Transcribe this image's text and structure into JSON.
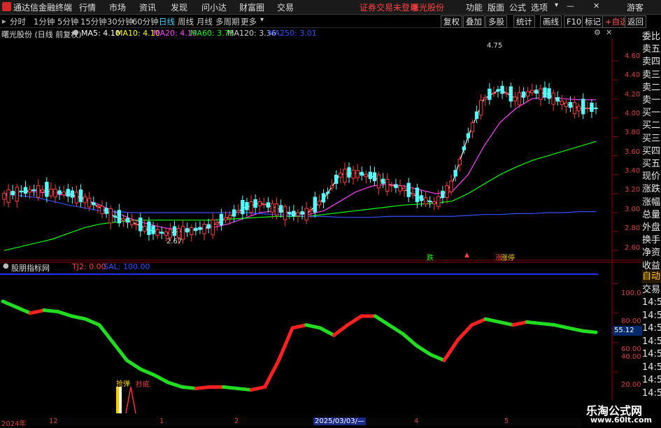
{
  "titlebar": {
    "app_title": "通达信金融终端",
    "menus": [
      "行情",
      "市场",
      "资讯",
      "发现",
      "问小达",
      "财富圈",
      "交易"
    ],
    "status_notice": "证券交易未登录",
    "stock_name": "曙光股份",
    "tools": [
      "功能",
      "版面",
      "公式",
      "选项"
    ],
    "guest": "游客"
  },
  "periods": [
    "分时",
    "1分钟",
    "5分钟",
    "15分钟",
    "30分钟",
    "60分钟",
    "日线",
    "周线",
    "月线",
    "多周期",
    "更多"
  ],
  "active_period": "日线",
  "toolbar_right": [
    "复权",
    "叠加",
    "多股",
    "统计",
    "画线",
    "F10",
    "标记",
    "+自选",
    "返回"
  ],
  "info": {
    "title": "曙光股份 (日线 前复权)",
    "ma5": "MA5: 4.10",
    "ma10": "MA10: 4.10",
    "ma20": "MA20: 4.19",
    "ma60": "MA60: 3.75",
    "ma120": "MA120: 3.36",
    "ma250": "MA250: 3.01"
  },
  "sidebar": [
    "委比",
    "卖五",
    "卖四",
    "卖三",
    "卖二",
    "卖一",
    "买一",
    "买二",
    "买三",
    "买四",
    "买五",
    "现价",
    "涨跌",
    "涨幅",
    "总量",
    "外盘",
    "换手",
    "净资",
    "收益"
  ],
  "sidebar_lower": [
    "自动",
    "交易",
    "14:56",
    "14:56",
    "14:56",
    "14:56",
    "14:56",
    "14:56",
    "14:56",
    "14:56",
    "14:56"
  ],
  "price_axis": [
    "4.60",
    "4.40",
    "4.20",
    "4.00",
    "3.80",
    "3.60",
    "3.40",
    "3.20",
    "3.00",
    "2.80",
    "2.60"
  ],
  "annotations": {
    "high": "4.75",
    "low": "2.67",
    "tag_die": "跌",
    "tag_zhang": "涨",
    "tag_jubian": "涨停"
  },
  "indicator": {
    "name": "股朋指标网",
    "tj2": "TJ2: 0.00",
    "sal": "SAL: 100.00",
    "axis": [
      "100.0",
      "80.00",
      "60.00",
      "40.00",
      "20.00"
    ],
    "current_value": "55.12",
    "signal_qiangtan": "抢弹",
    "signal_chaodi": "抄底"
  },
  "dates": [
    "2024年",
    "12",
    "1",
    "2",
    "2025/03/03/—",
    "4",
    "5"
  ],
  "watermark": {
    "brand": "乐淘公式网",
    "url": "www.60lt.com"
  },
  "colors": {
    "up": "#ff3b3b",
    "down": "#54ffff",
    "ma5": "#ffffff",
    "ma10": "#ffff00",
    "ma20": "#ff40ff",
    "ma60": "#00ff00",
    "ma120": "#c0c0c0",
    "ma250": "#3050ff"
  },
  "chart_data": {
    "type": "line",
    "title": "曙光股份 (日线 前复权)",
    "ylim": [
      2.55,
      4.8
    ],
    "series": [
      {
        "name": "MA5",
        "values": [
          3.18,
          3.22,
          3.24,
          3.22,
          3.2,
          3.15,
          3.05,
          2.95,
          2.9,
          2.82,
          2.78,
          2.8,
          2.82,
          2.86,
          2.95,
          3.05,
          3.1,
          3.05,
          2.98,
          3.0,
          3.15,
          3.4,
          3.42,
          3.38,
          3.3,
          3.25,
          3.15,
          3.1,
          3.3,
          3.8,
          4.2,
          4.3,
          4.2,
          4.28,
          4.25,
          4.15,
          4.1,
          4.1
        ]
      },
      {
        "name": "MA20",
        "values": [
          3.2,
          3.22,
          3.22,
          3.2,
          3.18,
          3.14,
          3.08,
          3.0,
          2.93,
          2.88,
          2.84,
          2.82,
          2.82,
          2.84,
          2.88,
          2.94,
          3.0,
          3.02,
          3.0,
          2.98,
          3.02,
          3.12,
          3.22,
          3.28,
          3.3,
          3.28,
          3.24,
          3.2,
          3.22,
          3.4,
          3.7,
          3.95,
          4.1,
          4.2,
          4.22,
          4.2,
          4.19,
          4.19
        ]
      },
      {
        "name": "MA60",
        "values": [
          2.6,
          2.64,
          2.68,
          2.72,
          2.78,
          2.84,
          2.88,
          2.9,
          2.92,
          2.92,
          2.92,
          2.92,
          2.92,
          2.92,
          2.93,
          2.94,
          2.95,
          2.96,
          2.96,
          2.96,
          2.98,
          3.0,
          3.02,
          3.04,
          3.06,
          3.08,
          3.09,
          3.1,
          3.12,
          3.2,
          3.3,
          3.4,
          3.48,
          3.55,
          3.6,
          3.65,
          3.7,
          3.75
        ]
      },
      {
        "name": "MA250",
        "values": [
          3.2,
          3.18,
          3.16,
          3.12,
          3.08,
          3.05,
          3.02,
          3.01,
          3.0,
          3.0,
          3.0,
          3.0,
          3.0,
          3.0,
          3.0,
          3.0,
          2.99,
          2.98,
          2.97,
          2.96,
          2.96,
          2.95,
          2.95,
          2.95,
          2.96,
          2.96,
          2.96,
          2.96,
          2.96,
          2.97,
          2.98,
          2.98,
          2.99,
          2.99,
          3.0,
          3.0,
          3.01,
          3.01
        ]
      }
    ],
    "indicator_series": {
      "name": "股朋指标网",
      "ylim": [
        15,
        105
      ],
      "values": [
        88,
        84,
        80,
        82,
        81,
        78,
        76,
        72,
        60,
        48,
        42,
        38,
        33,
        30,
        29,
        30,
        30,
        29,
        28,
        30,
        48,
        70,
        72,
        70,
        65,
        72,
        78,
        78,
        72,
        66,
        58,
        52,
        48,
        62,
        72,
        76,
        74,
        72,
        74,
        73,
        72,
        70,
        68,
        67
      ]
    }
  }
}
